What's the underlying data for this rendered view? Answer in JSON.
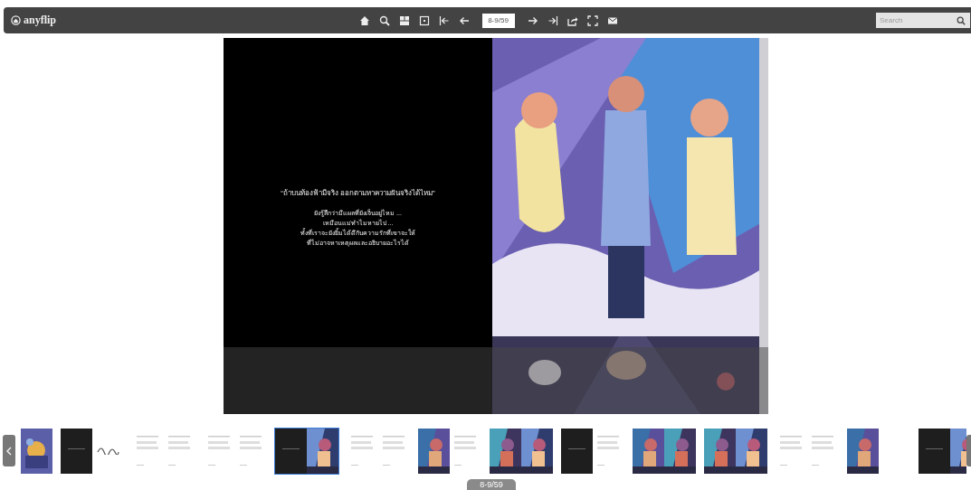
{
  "app": {
    "logo": "anyflip"
  },
  "toolbar": {
    "page_field": {
      "value": "8-9/59"
    }
  },
  "search": {
    "placeholder": "Search"
  },
  "left_page": {
    "quote": "“ถ้าบนท้องฟ้ามีจริง ออกตามหาความฝันจริงได้ไหม”",
    "lines": [
      "ยังรู้สึกว่ามีแผลที่ยังเจ็บอยู่ไหม ...",
      "เหมือนแม่ทำไมหายไป ...",
      "ทั้งที่เราจะยังยิ้มได้ดีกับความรักที่เขาจะให้",
      "ที่ไม่อาจหาเหตุผลและอธิบายอะไรได้"
    ]
  },
  "thumbnails": [
    {
      "pages": [
        {
          "kind": "cover"
        }
      ],
      "selected": false
    },
    {
      "pages": [
        {
          "kind": "dark"
        },
        {
          "kind": "sketch"
        }
      ],
      "selected": false
    },
    {
      "pages": [
        {
          "kind": "text"
        },
        {
          "kind": "text"
        }
      ],
      "selected": false
    },
    {
      "pages": [
        {
          "kind": "text"
        },
        {
          "kind": "text"
        }
      ],
      "selected": false
    },
    {
      "pages": [
        {
          "kind": "dark"
        },
        {
          "kind": "picture"
        }
      ],
      "selected": true
    },
    {
      "pages": [
        {
          "kind": "text"
        },
        {
          "kind": "text"
        }
      ],
      "selected": false
    },
    {
      "pages": [
        {
          "kind": "picture"
        },
        {
          "kind": "text"
        }
      ],
      "selected": false
    },
    {
      "pages": [
        {
          "kind": "picture"
        },
        {
          "kind": "picture"
        }
      ],
      "selected": false
    },
    {
      "pages": [
        {
          "kind": "dark"
        },
        {
          "kind": "text"
        }
      ],
      "selected": false
    },
    {
      "pages": [
        {
          "kind": "picture"
        },
        {
          "kind": "picture"
        }
      ],
      "selected": false
    },
    {
      "pages": [
        {
          "kind": "picture"
        },
        {
          "kind": "picture"
        }
      ],
      "selected": false
    },
    {
      "pages": [
        {
          "kind": "text"
        },
        {
          "kind": "text"
        }
      ],
      "selected": false
    },
    {
      "pages": [
        {
          "kind": "picture"
        },
        {
          "kind": "blank"
        }
      ],
      "selected": false
    },
    {
      "pages": [
        {
          "kind": "dark"
        },
        {
          "kind": "picture"
        }
      ],
      "selected": false
    }
  ],
  "page_badge": "8-9/59"
}
